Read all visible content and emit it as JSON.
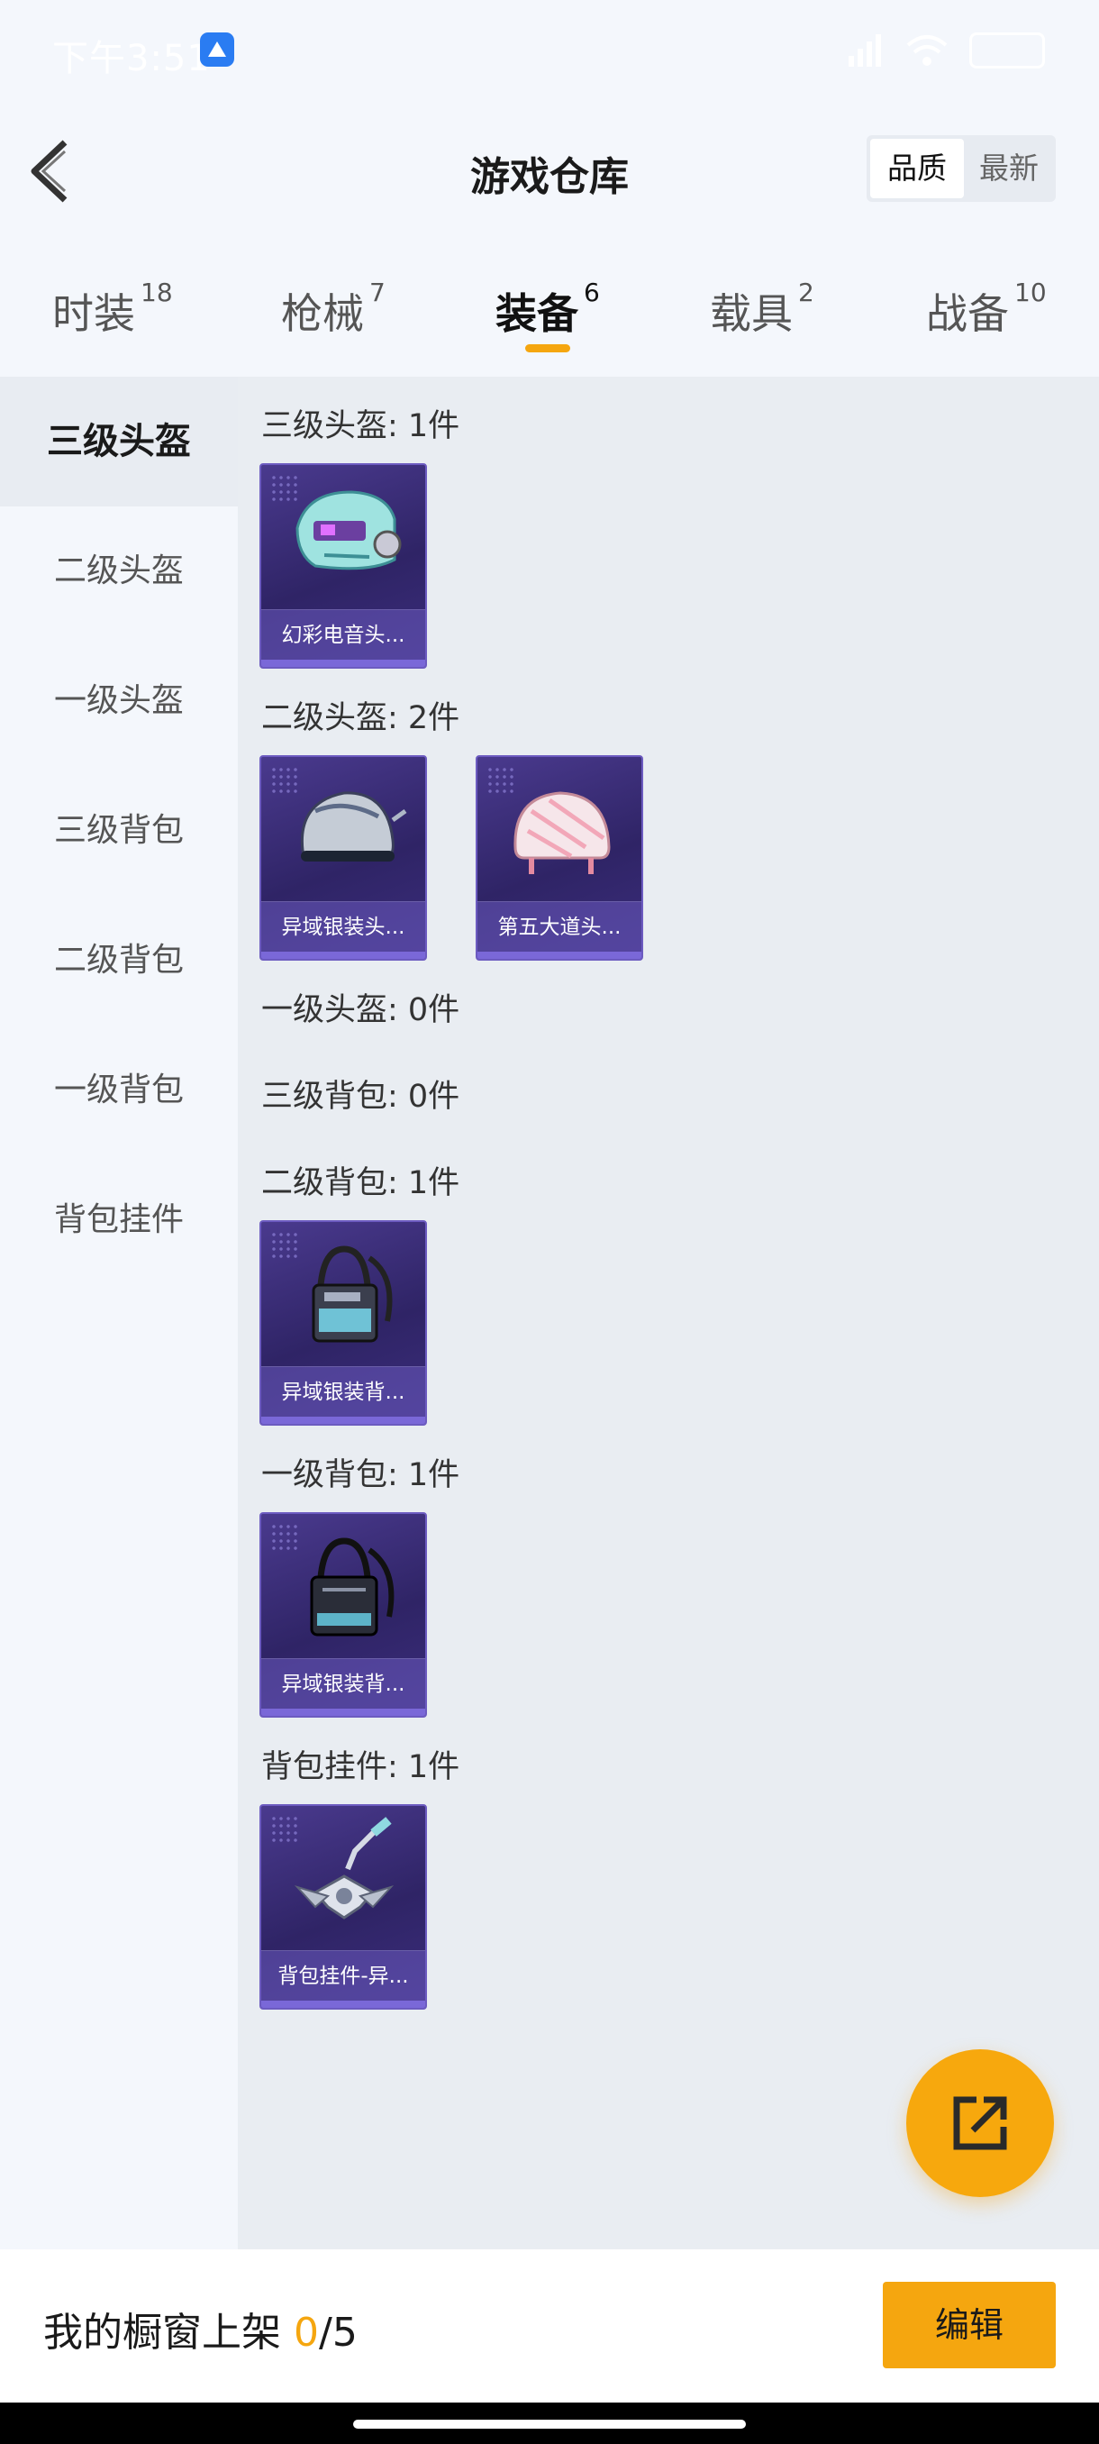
{
  "status_bar": {
    "time": "下午3:51"
  },
  "header": {
    "title": "游戏仓库",
    "sort_options": [
      "品质",
      "最新"
    ],
    "active_sort": "品质"
  },
  "tabs": [
    {
      "label": "时装",
      "count": "18"
    },
    {
      "label": "枪械",
      "count": "7"
    },
    {
      "label": "装备",
      "count": "6"
    },
    {
      "label": "载具",
      "count": "2"
    },
    {
      "label": "战备",
      "count": "10"
    }
  ],
  "active_tab": "装备",
  "sidebar": {
    "items": [
      "三级头盔",
      "二级头盔",
      "一级头盔",
      "三级背包",
      "二级背包",
      "一级背包",
      "背包挂件"
    ],
    "active": "三级头盔"
  },
  "sections": [
    {
      "title": "三级头盔: 1件",
      "items": [
        "幻彩电音头..."
      ]
    },
    {
      "title": "二级头盔: 2件",
      "items": [
        "异域银装头...",
        "第五大道头..."
      ]
    },
    {
      "title": "一级头盔: 0件",
      "items": []
    },
    {
      "title": "三级背包: 0件",
      "items": []
    },
    {
      "title": "二级背包: 1件",
      "items": [
        "异域银装背..."
      ]
    },
    {
      "title": "一级背包: 1件",
      "items": [
        "异域银装背..."
      ]
    },
    {
      "title": "背包挂件: 1件",
      "items": [
        "背包挂件-异..."
      ]
    }
  ],
  "item_icons": [
    "helmet-icon",
    "helmet-icon",
    "helmet-icon",
    "backpack-icon",
    "backpack-icon",
    "pendant-icon"
  ],
  "fab": {
    "icon": "share-external-icon"
  },
  "bottom_bar": {
    "label": "我的橱窗上架",
    "count": "0",
    "total": "/5",
    "edit_label": "编辑"
  },
  "colors": {
    "accent": "#f5a60f",
    "card": "#3b2d7c"
  }
}
